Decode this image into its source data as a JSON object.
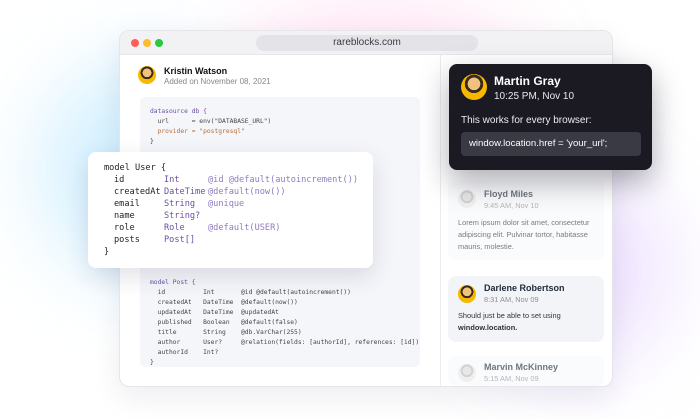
{
  "browser": {
    "url": "rareblocks.com"
  },
  "post": {
    "author": "Kristin Watson",
    "date": "Added on November 08, 2021"
  },
  "code_top": {
    "line1": "datasource db {",
    "line2": "  url      = env(\"DATABASE_URL\")",
    "line3": "  provider = \"postgresql\"",
    "line4": "}"
  },
  "schema_card": {
    "l1": "model User {",
    "l2_field": "id",
    "l2_type": "Int",
    "l2_attr": "@id @default(autoincrement())",
    "l3_field": "createdAt",
    "l3_type": "DateTime",
    "l3_attr": "@default(now())",
    "l4_field": "email",
    "l4_type": "String",
    "l4_attr": "@unique",
    "l5_field": "name",
    "l5_type": "String?",
    "l6_field": "role",
    "l6_type": "Role",
    "l6_attr": "@default(USER)",
    "l7_field": "posts",
    "l7_type": "Post[]",
    "l8": "}"
  },
  "code_bottom": {
    "l1": "model Post {",
    "l2": "  id          Int       @id @default(autoincrement())",
    "l3": "  createdAt   DateTime  @default(now())",
    "l4": "  updatedAt   DateTime  @updatedAt",
    "l5": "  published   Boolean   @default(false)",
    "l6": "  title       String    @db.VarChar(255)",
    "l7": "  author      User?     @relation(fields: [authorId], references: [id])",
    "l8": "  authorId    Int?",
    "l9": "}"
  },
  "dark_comment": {
    "name": "Martin Gray",
    "time": "10:25 PM, Nov 10",
    "body": "This works for every browser:",
    "code": "window.location.href = 'your_url';"
  },
  "comments": [
    {
      "name": "Floyd Miles",
      "time": "9:45 AM, Nov 10",
      "body": "Lorem ipsum dolor sit amet, consectetur adipiscing elit. Pulvinar tortor, habitasse mauris, molestie."
    },
    {
      "name": "Darlene Robertson",
      "time": "8:31 AM, Nov 09",
      "body_prefix": "Should just be able to set using ",
      "body_code": "window.location."
    },
    {
      "name": "Marvin McKinney",
      "time": "5:15 AM, Nov 09"
    }
  ],
  "colors": {
    "dark_card": "#1b1a23",
    "code_type": "#6b4fa0",
    "code_string": "#b86a3e"
  }
}
